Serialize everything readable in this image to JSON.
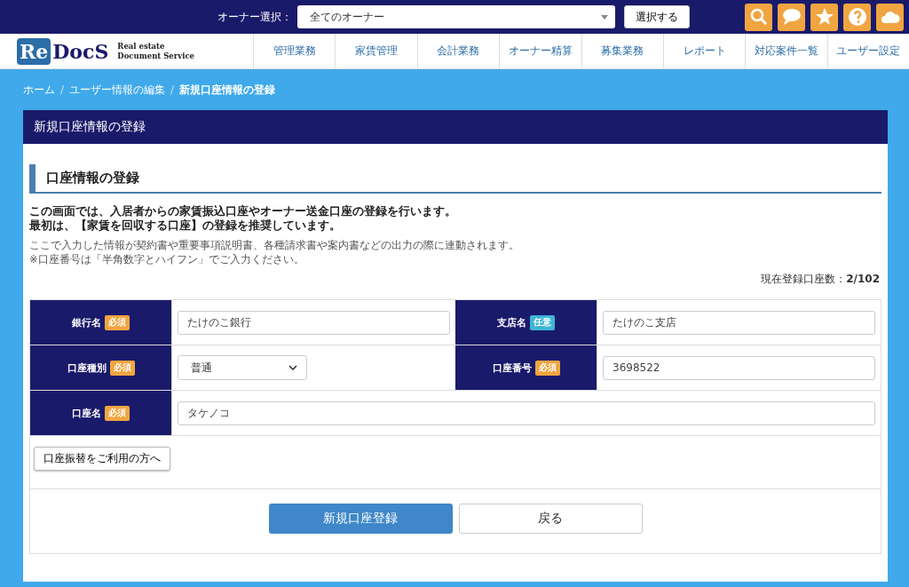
{
  "topbar": {
    "owner_label": "オーナー選択：",
    "owner_select": "全てのオーナー",
    "select_button": "選択する"
  },
  "logo": {
    "mark": "Re",
    "name": "DocS",
    "tagline_1": "Real estate",
    "tagline_2": "Document Service"
  },
  "nav": [
    "管理業務",
    "家賃管理",
    "会計業務",
    "オーナー精算",
    "募集業務",
    "レポート",
    "対応案件一覧",
    "ユーザー設定"
  ],
  "breadcrumb_separator": "/",
  "breadcrumb": [
    {
      "label": "ホーム",
      "current": false
    },
    {
      "label": "ユーザー情報の編集",
      "current": false
    },
    {
      "label": "新規口座情報の登録",
      "current": true
    }
  ],
  "panel": {
    "title": "新規口座情報の登録",
    "section_title": "口座情報の登録",
    "lead_1": "この画面では、入居者からの家賃振込口座やオーナー送金口座の登録を行います。",
    "lead_2": "最初は、【家賃を回収する口座】の登録を推奨しています。",
    "note_1": "ここで入力した情報が契約書や重要事項説明書、各種請求書や案内書などの出力の際に連動されます。",
    "note_2": "※口座番号は「半角数字とハイフン」でご入力ください。",
    "count_label": "現在登録口座数：",
    "count_value": "2/102"
  },
  "form_rows": [
    [
      {
        "label": "銀行名",
        "badge": "必須",
        "color": "#f0a541",
        "kind": "input",
        "value": "たけのこ銀行"
      },
      {
        "label": "支店名",
        "badge": "任意",
        "color": "#3fb4d6",
        "kind": "input",
        "value": "たけのこ支店"
      }
    ],
    [
      {
        "label": "口座種別",
        "badge": "必須",
        "color": "#f0a541",
        "kind": "select",
        "value": "普通"
      },
      {
        "label": "口座番号",
        "badge": "必須",
        "color": "#f0a541",
        "kind": "input",
        "value": "3698522"
      }
    ],
    [
      {
        "label": "口座名",
        "badge": "必須",
        "color": "#f0a541",
        "kind": "input",
        "value": "タケノコ"
      }
    ]
  ],
  "transfer_button": "口座振替をご利用の方へ",
  "buttons": [
    {
      "label": "新規口座登録",
      "kind": "primary"
    },
    {
      "label": "戻る",
      "kind": "secondary"
    }
  ]
}
